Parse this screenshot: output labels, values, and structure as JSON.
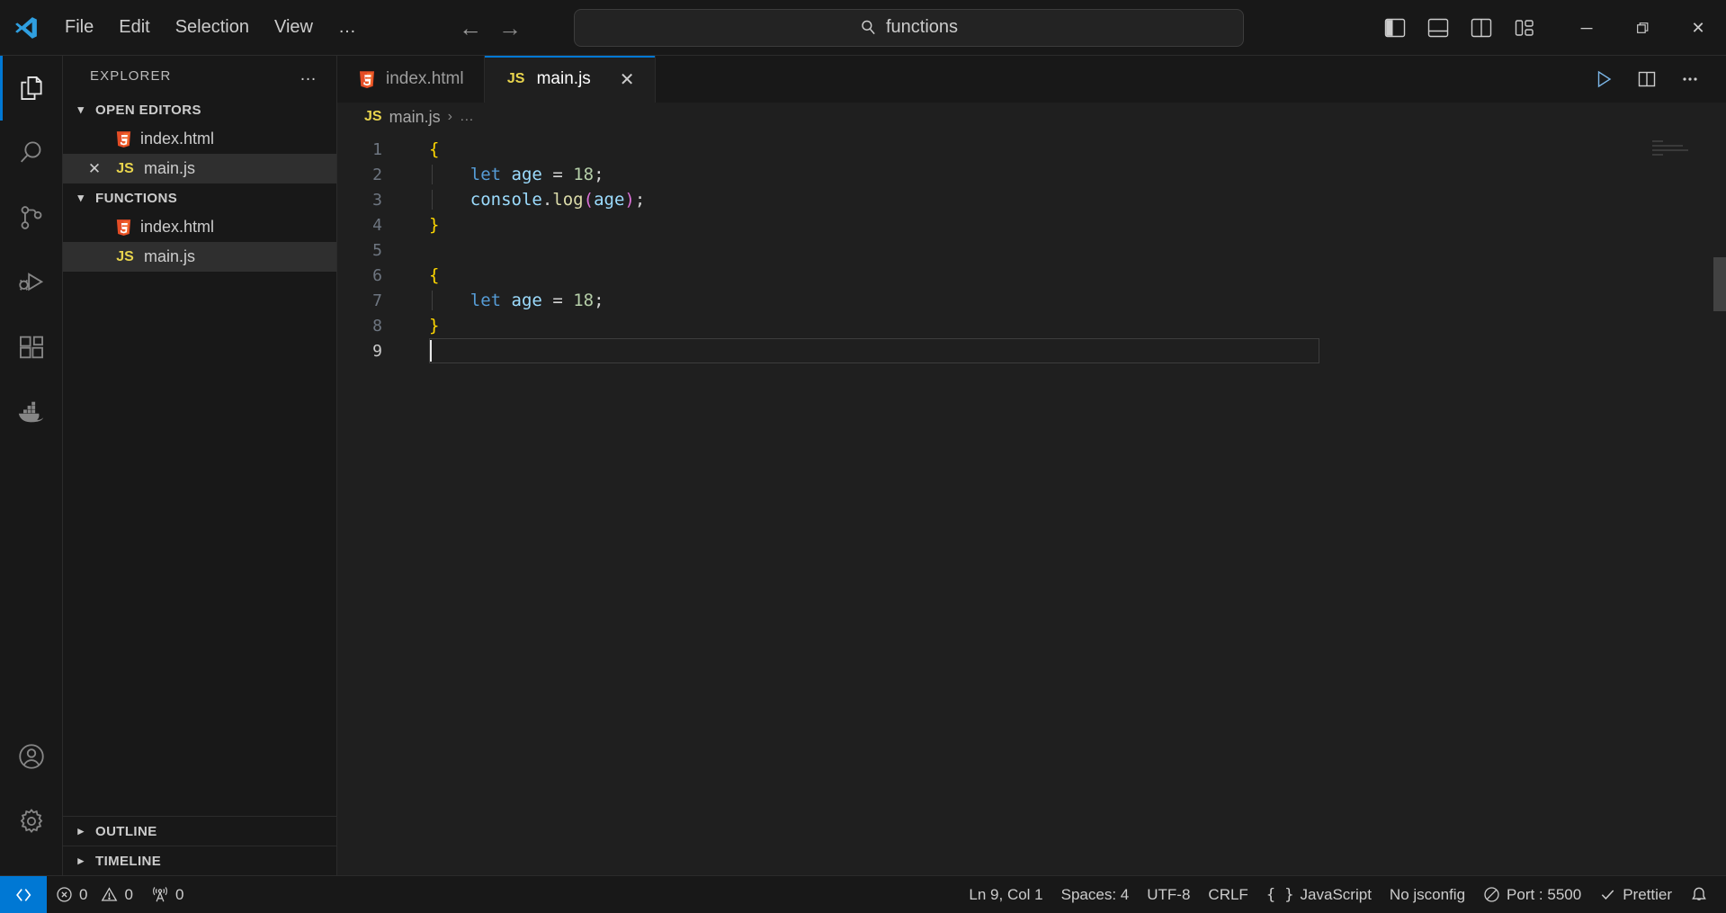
{
  "titlebar": {
    "logo_icon": "vscode-logo",
    "menus": [
      "File",
      "Edit",
      "Selection",
      "View",
      "…"
    ],
    "back_icon": "arrow-left-icon",
    "forward_icon": "arrow-right-icon",
    "search": {
      "icon": "search-icon",
      "value": "functions"
    },
    "layout_buttons": [
      {
        "name": "toggle-primary-sidebar",
        "icon": "panel-left-icon"
      },
      {
        "name": "toggle-panel",
        "icon": "panel-bottom-icon"
      },
      {
        "name": "toggle-secondary-sidebar",
        "icon": "panel-right-icon"
      },
      {
        "name": "customize-layout",
        "icon": "layout-grid-icon"
      }
    ],
    "window_controls": [
      {
        "name": "minimize-button",
        "glyph": "─"
      },
      {
        "name": "maximize-button",
        "glyph": "❐"
      },
      {
        "name": "close-button",
        "glyph": "✕"
      }
    ]
  },
  "activitybar": {
    "items": [
      {
        "name": "explorer",
        "icon": "files-icon",
        "active": true
      },
      {
        "name": "search",
        "icon": "search-icon",
        "active": false
      },
      {
        "name": "source-control",
        "icon": "source-control-icon",
        "active": false
      },
      {
        "name": "run-and-debug",
        "icon": "run-debug-icon",
        "active": false
      },
      {
        "name": "extensions",
        "icon": "extensions-icon",
        "active": false
      },
      {
        "name": "docker",
        "icon": "docker-icon",
        "active": false
      }
    ],
    "bottom_items": [
      {
        "name": "accounts",
        "icon": "account-icon"
      },
      {
        "name": "manage-settings",
        "icon": "gear-icon"
      }
    ]
  },
  "sidebar": {
    "title": "EXPLORER",
    "more_actions": "…",
    "sections": [
      {
        "label": "OPEN EDITORS",
        "expanded": true,
        "items": [
          {
            "label": "index.html",
            "icon": "html5-icon",
            "selected": false,
            "closeable": false
          },
          {
            "label": "main.js",
            "icon": "js-icon",
            "selected": true,
            "closeable": true
          }
        ]
      },
      {
        "label": "FUNCTIONS",
        "expanded": true,
        "items": [
          {
            "label": "index.html",
            "icon": "html5-icon",
            "selected": false,
            "closeable": false
          },
          {
            "label": "main.js",
            "icon": "js-icon",
            "selected": true,
            "closeable": false
          }
        ]
      }
    ],
    "collapsed_sections": [
      {
        "label": "OUTLINE"
      },
      {
        "label": "TIMELINE"
      }
    ]
  },
  "editor": {
    "tabs": [
      {
        "label": "index.html",
        "icon": "html5-icon",
        "active": false,
        "closeable": false
      },
      {
        "label": "main.js",
        "icon": "js-icon",
        "active": true,
        "closeable": true
      }
    ],
    "actions": [
      {
        "name": "run-code-button",
        "icon": "play-icon"
      },
      {
        "name": "split-editor-right-button",
        "icon": "split-editor-icon"
      },
      {
        "name": "more-actions-button",
        "icon": "ellipsis-icon"
      }
    ],
    "breadcrumb": {
      "file_badge": "JS",
      "file": "main.js",
      "separator": "›",
      "tail": "…"
    },
    "code": {
      "language": "javascript",
      "current_line": 9,
      "lines": [
        {
          "n": 1,
          "text": "{"
        },
        {
          "n": 2,
          "text": "    let age = 18;"
        },
        {
          "n": 3,
          "text": "    console.log(age);"
        },
        {
          "n": 4,
          "text": "}"
        },
        {
          "n": 5,
          "text": ""
        },
        {
          "n": 6,
          "text": "{"
        },
        {
          "n": 7,
          "text": "    let age = 18;"
        },
        {
          "n": 8,
          "text": "}"
        },
        {
          "n": 9,
          "text": ""
        }
      ]
    }
  },
  "statusbar": {
    "remote_icon": "remote-window-icon",
    "left_items": [
      {
        "name": "problems-errors",
        "icon": "error-circle-icon",
        "value": "0"
      },
      {
        "name": "problems-warnings",
        "icon": "warning-triangle-icon",
        "value": "0"
      },
      {
        "name": "ports",
        "icon": "radio-tower-icon",
        "value": "0"
      }
    ],
    "right_items": [
      {
        "name": "editor-position",
        "label": "Ln 9, Col 1"
      },
      {
        "name": "editor-indentation",
        "label": "Spaces: 4"
      },
      {
        "name": "editor-encoding",
        "label": "UTF-8"
      },
      {
        "name": "editor-eol",
        "label": "CRLF"
      },
      {
        "name": "editor-language",
        "label": "JavaScript",
        "icon": "braces-icon"
      },
      {
        "name": "jsconfig-status",
        "label": "No jsconfig"
      },
      {
        "name": "live-server-port",
        "label": "Port : 5500",
        "icon": "circle-slash-icon"
      },
      {
        "name": "prettier-status",
        "label": "Prettier",
        "icon": "check-icon"
      }
    ],
    "notifications_icon": "bell-icon"
  },
  "colors": {
    "accent": "#0078d4",
    "titlebar_bg": "#181818",
    "editor_bg": "#1f1f1f",
    "sidebar_bg": "#181818",
    "selection_bg": "#2f2f2f",
    "js_yellow": "#e8d44d",
    "html_orange": "#e44d26"
  }
}
